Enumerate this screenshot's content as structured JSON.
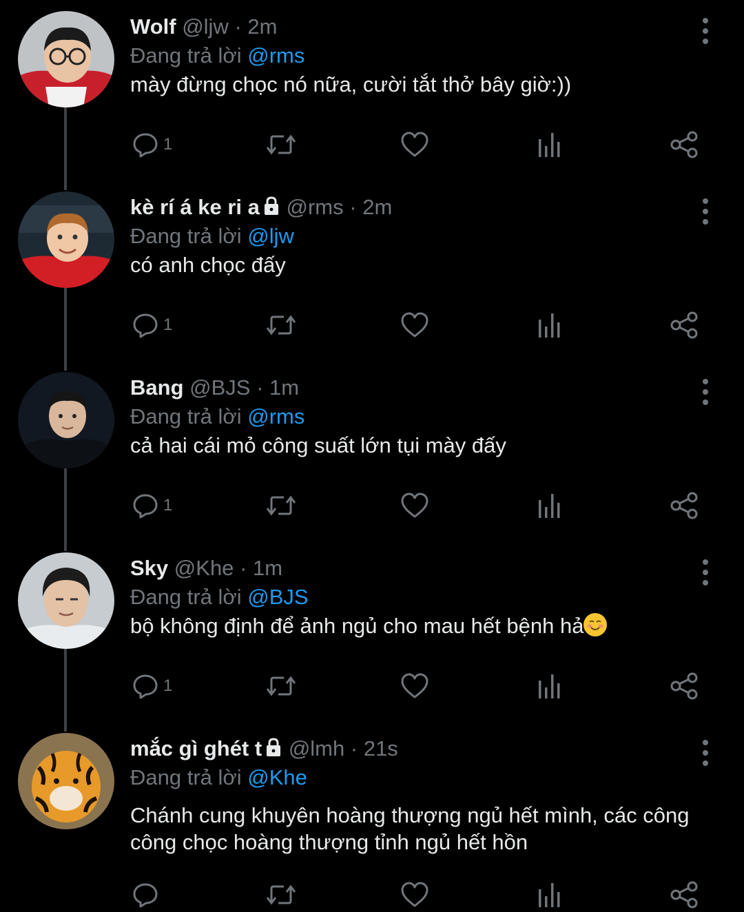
{
  "tweets": [
    {
      "name": "Wolf",
      "locked": false,
      "handle": "@ljw",
      "dot": "·",
      "time": "2m",
      "reply_prefix": "Đang trả lời",
      "reply_to": "@rms",
      "text": "mày đừng chọc nó nữa, cười tắt thở bây giờ:))",
      "reply_count": "1"
    },
    {
      "name": "kè rí á ke ri a",
      "locked": true,
      "handle": "@rms",
      "dot": "·",
      "time": "2m",
      "reply_prefix": "Đang trả lời",
      "reply_to": "@ljw",
      "text": "có anh chọc đấy",
      "reply_count": "1"
    },
    {
      "name": "Bang",
      "locked": false,
      "handle": "@BJS",
      "dot": "·",
      "time": "1m",
      "reply_prefix": "Đang trả lời",
      "reply_to": "@rms",
      "text": "cả hai cái mỏ công suất lớn tụi mày đấy",
      "reply_count": "1"
    },
    {
      "name": "Sky",
      "locked": false,
      "handle": "@Khe",
      "dot": "·",
      "time": "1m",
      "reply_prefix": "Đang trả lời",
      "reply_to": "@BJS",
      "text": "bộ không định để ảnh ngủ cho mau hết bệnh hả",
      "emoji": "smiling-face-emoji",
      "reply_count": "1"
    },
    {
      "name": "mắc gì ghét t",
      "locked": true,
      "handle": "@lmh",
      "dot": "·",
      "time": "21s",
      "reply_prefix": "Đang trả lời",
      "reply_to": "@Khe",
      "text_lines": [
        "Chánh cung khuyên hoàng thượng ngủ hết mình, các công",
        "công chọc hoàng thượng tỉnh ngủ hết hồn"
      ],
      "reply_count": ""
    }
  ],
  "icons": [
    "reply-icon",
    "retweet-icon",
    "like-icon",
    "views-icon",
    "share-icon",
    "more-icon",
    "lock-icon"
  ],
  "colors": {
    "background": "#000000",
    "text": "#e7e9ea",
    "muted": "#71767b",
    "mention": "#1d9bf0",
    "thread_line": "#3e4144"
  }
}
